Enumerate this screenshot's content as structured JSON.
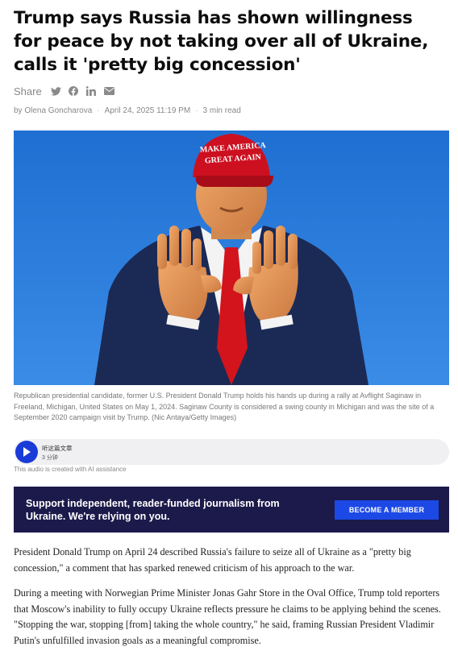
{
  "article": {
    "title": "Trump says Russia has shown willingness for peace by not taking over all of Ukraine, calls it 'pretty big concession'",
    "share_label": "Share",
    "share_icons": [
      "twitter-icon",
      "facebook-icon",
      "linkedin-icon",
      "mail-icon"
    ],
    "byline": {
      "author": "by Olena Goncharova",
      "date": "April 24, 2025 11:19 PM",
      "read_time": "3 min read"
    },
    "photo": {
      "hat_text_line1": "MAKE AMERICA",
      "hat_text_line2": "GREAT AGAIN"
    },
    "caption": "Republican presidential candidate, former U.S. President Donald Trump holds his hands up during a rally at Avflight Saginaw in Freeland, Michigan, United States on May 1, 2024. Saginaw County is considered a swing county in Michigan and was the site of a September 2020 campaign visit by Trump. (Nic Antaya/Getty Images)",
    "audio": {
      "title": "听这篇文章",
      "duration": "3 分钟",
      "note": "This audio is created with AI assistance"
    },
    "banner": {
      "text": "Support independent, reader-funded journalism from Ukraine. We're relying on you.",
      "button": "BECOME A MEMBER"
    },
    "paragraphs": [
      "President Donald Trump on April 24 described Russia's failure to seize all of Ukraine as a \"pretty big concession,\" a comment that has sparked renewed criticism of his approach to the war.",
      "During a meeting with Norwegian Prime Minister Jonas Gahr Store in the Oval Office, Trump told reporters that Moscow's inability to fully occupy Ukraine reflects pressure he claims to be applying behind the scenes. \"Stopping the war, stopping [from] taking the whole country,\" he said, framing Russian President Vladimir Putin's unfulfilled invasion goals as a meaningful compromise."
    ]
  },
  "colors": {
    "title": "#0d0d0d",
    "sky": "#2a78d6",
    "suit": "#1b2a55",
    "tie": "#d3141c",
    "hat": "#cc1020",
    "banner_bg": "#1c1a4b",
    "button_bg": "#1c49e6",
    "play_bg": "#1a3bd8"
  }
}
